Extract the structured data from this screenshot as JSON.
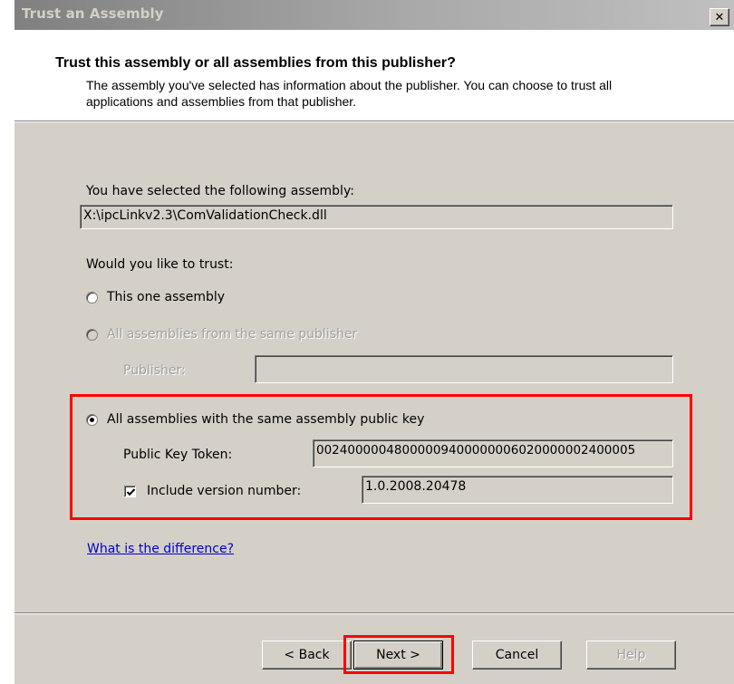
{
  "window": {
    "title": "Trust an Assembly",
    "close_glyph": "✕"
  },
  "header": {
    "title": "Trust this assembly or all assemblies from this publisher?",
    "description": "The assembly you've selected has information about the publisher. You can choose to trust all applications and assemblies from that publisher."
  },
  "assembly": {
    "label": "You have selected the following assembly:",
    "path": "X:\\ipcLinkv2.3\\ComValidationCheck.dll"
  },
  "trust": {
    "question": "Would you like to trust:",
    "options": [
      {
        "label": "This one assembly",
        "checked": false,
        "enabled": true
      },
      {
        "label": "All assemblies from the same publisher",
        "checked": false,
        "enabled": false
      },
      {
        "label": "All assemblies with the same assembly public key",
        "checked": true,
        "enabled": true
      }
    ],
    "publisher_label": "Publisher:",
    "publisher_value": "",
    "public_key_label": "Public Key Token:",
    "public_key_value": "00240000048000009400000006020000002400005",
    "include_version_label": "Include version number:",
    "include_version_checked": true,
    "version_value": "1.0.2008.20478"
  },
  "help_link": "What is the difference?",
  "buttons": {
    "back": "< Back",
    "next": "Next >",
    "cancel": "Cancel",
    "help": "Help"
  },
  "colors": {
    "dialog_bg": "#d4d0c8",
    "highlight": "#ff0000",
    "link": "#0000cc"
  }
}
